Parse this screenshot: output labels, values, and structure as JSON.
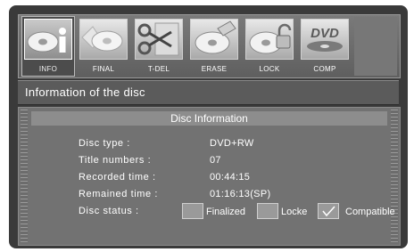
{
  "toolbar": {
    "items": [
      {
        "label": "INFO",
        "icon": "disc-info-icon"
      },
      {
        "label": "FINAL",
        "icon": "disc-finalize-icon"
      },
      {
        "label": "T-DEL",
        "icon": "scissors-icon"
      },
      {
        "label": "ERASE",
        "icon": "disc-erase-icon"
      },
      {
        "label": "LOCK",
        "icon": "disc-lock-icon"
      },
      {
        "label": "COMP",
        "icon": "dvd-logo-icon"
      }
    ],
    "selected": "INFO",
    "logo_text": "DVD"
  },
  "section_header": "Information of the disc",
  "panel": {
    "title": "Disc Information",
    "rows": [
      {
        "label": "Disc  type :",
        "value": "DVD+RW"
      },
      {
        "label": "Title  numbers  :",
        "value": "07"
      },
      {
        "label": "Recorded  time  :",
        "value": "00:44:15"
      },
      {
        "label": "Remained  time :",
        "value": "01:16:13(SP)"
      }
    ],
    "status": {
      "label": "Disc  status :",
      "options": [
        {
          "label": "Finalized",
          "checked": false
        },
        {
          "label": "Locke",
          "checked": false
        },
        {
          "label": "Compatible",
          "checked": true
        }
      ]
    }
  }
}
